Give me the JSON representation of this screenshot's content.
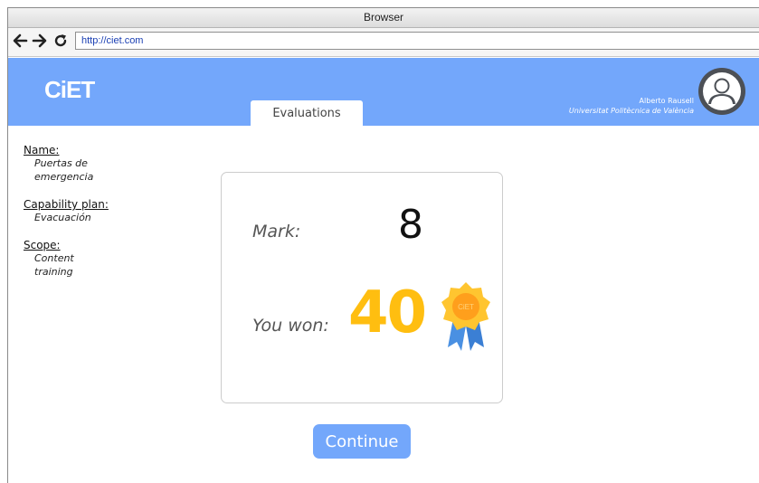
{
  "browser": {
    "title": "Browser",
    "url": "http://ciet.com",
    "icons": [
      "back-arrow-icon",
      "forward-arrow-icon",
      "reload-icon"
    ]
  },
  "header": {
    "logo": "CiET",
    "tab_evaluations": "Evaluations",
    "user_name": "Alberto Rausell",
    "user_org": "Universitat Politècnica de València",
    "avatar_icon": "user-avatar-icon",
    "accent_color": "#73a7fb"
  },
  "sidebar": {
    "name_label": "Name:",
    "name_value_line1": "Puertas de",
    "name_value_line2": "emergencia",
    "plan_label": "Capability plan:",
    "plan_value": "Evacuación",
    "scope_label": "Scope:",
    "scope_value_line1": "Content",
    "scope_value_line2": "training"
  },
  "result": {
    "mark_label": "Mark:",
    "mark_value": "8",
    "won_label": "You won:",
    "won_value": "40",
    "badge_text": "CiET",
    "badge_icon": "award-badge-icon",
    "points_color": "#ffbe10"
  },
  "actions": {
    "continue_label": "Continue"
  }
}
